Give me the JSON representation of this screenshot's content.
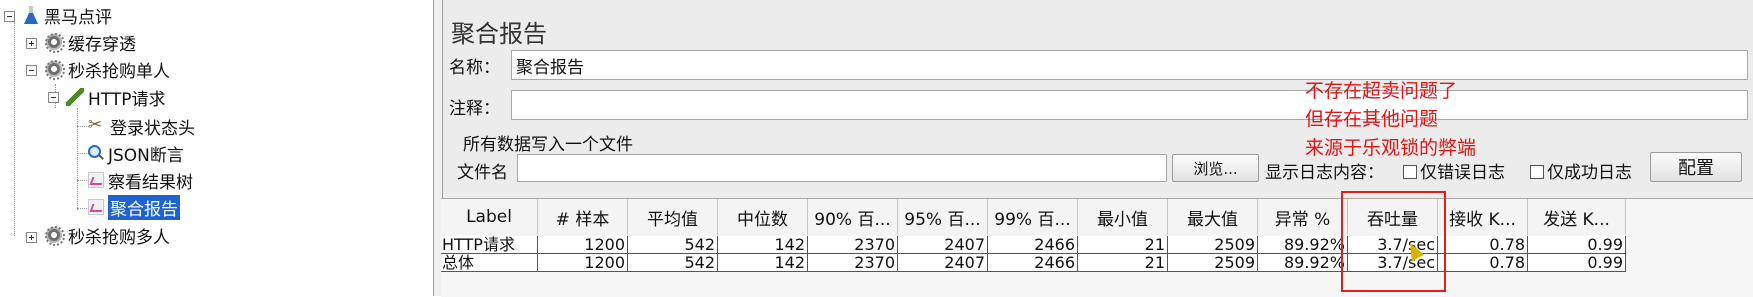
{
  "tree": {
    "root": "黑马点评",
    "cache": "缓存穿透",
    "seckill_single": "秒杀抢购单人",
    "http_request": "HTTP请求",
    "login_header": "登录状态头",
    "json_assert": "JSON断言",
    "view_results": "察看结果树",
    "aggregate": "聚合报告",
    "seckill_multi": "秒杀抢购多人"
  },
  "panel": {
    "title": "聚合报告",
    "name_label": "名称：",
    "name_value": "聚合报告",
    "comment_label": "注释：",
    "comment_value": "",
    "file_group_title": "所有数据写入一个文件",
    "filename_label": "文件名",
    "filename_value": "",
    "browse_button": "浏览...",
    "log_content_label": "显示日志内容：",
    "errors_only_label": "仅错误日志",
    "success_only_label": "仅成功日志",
    "config_button": "配置"
  },
  "annotation": {
    "line1": "不存在超卖问题了",
    "line2": "但存在其他问题",
    "line3": "来源于乐观锁的弊端",
    "color": "#e01515"
  },
  "table": {
    "headers": [
      "Label",
      "# 样本",
      "平均值",
      "中位数",
      "90% 百...",
      "95% 百...",
      "99% 百...",
      "最小值",
      "最大值",
      "异常 %",
      "吞吐量",
      "接收 K...",
      "发送 K..."
    ],
    "rows": [
      [
        "HTTP请求",
        "1200",
        "542",
        "142",
        "2370",
        "2407",
        "2466",
        "21",
        "2509",
        "89.92%",
        "3.7/sec",
        "0.78",
        "0.99"
      ],
      [
        "总体",
        "1200",
        "542",
        "142",
        "2370",
        "2407",
        "2466",
        "21",
        "2509",
        "89.92%",
        "3.7/sec",
        "0.78",
        "0.99"
      ]
    ]
  },
  "colors": {
    "selection": "#1e63cf",
    "highlight_box": "#e02020",
    "panel_bg": "#ececec"
  }
}
